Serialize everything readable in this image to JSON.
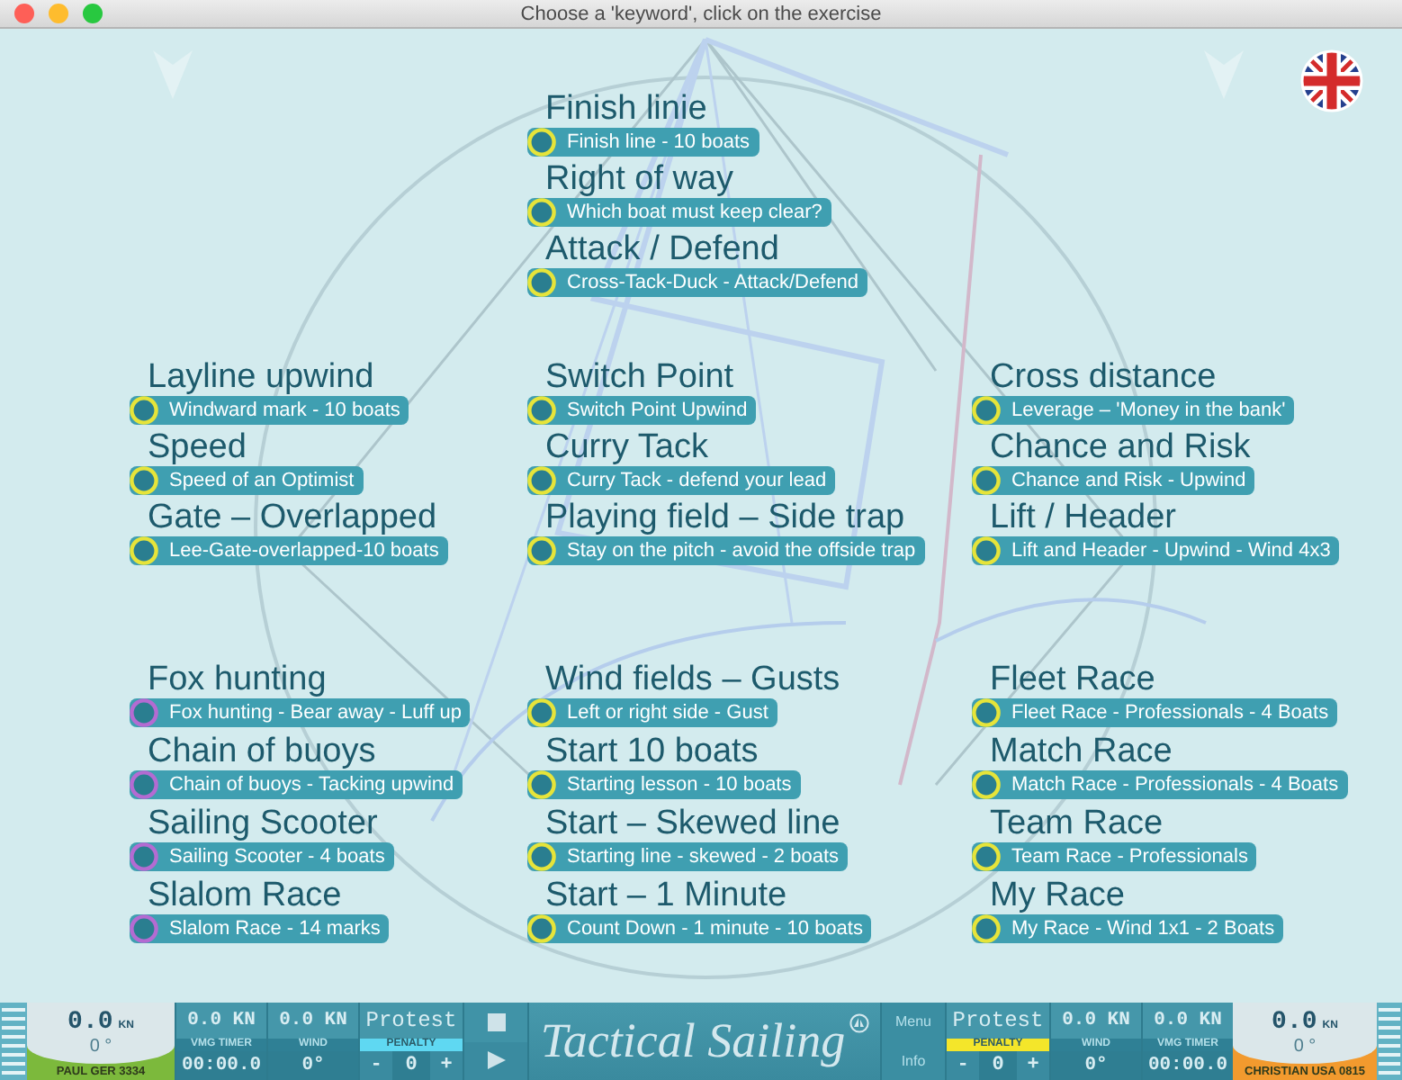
{
  "window": {
    "title": "Choose a 'keyword', click on the exercise"
  },
  "top_group": {
    "items": [
      {
        "heading": "Finish linie",
        "exercise": "Finish line - 10 boats",
        "color": "#e6e43a"
      },
      {
        "heading": "Right of way",
        "exercise": "Which boat must keep clear?",
        "color": "#e6e43a"
      },
      {
        "heading": "Attack / Defend",
        "exercise": "Cross-Tack-Duck - Attack/Defend",
        "color": "#e6e43a"
      }
    ]
  },
  "rows": [
    {
      "columns": [
        {
          "items": [
            {
              "heading": "Layline upwind",
              "exercise": "Windward mark - 10 boats",
              "color": "#e6e43a"
            },
            {
              "heading": "Speed",
              "exercise": "Speed of an Optimist",
              "color": "#e6e43a"
            },
            {
              "heading": "Gate – Overlapped",
              "exercise": "Lee-Gate-overlapped-10 boats",
              "color": "#e6e43a"
            }
          ]
        },
        {
          "items": [
            {
              "heading": "Switch Point",
              "exercise": "Switch Point Upwind",
              "color": "#e6e43a"
            },
            {
              "heading": "Curry Tack",
              "exercise": "Curry Tack - defend your lead",
              "color": "#e6e43a"
            },
            {
              "heading": "Playing field – Side trap",
              "exercise": "Stay on the pitch - avoid the offside trap",
              "color": "#e6e43a"
            }
          ]
        },
        {
          "items": [
            {
              "heading": "Cross distance",
              "exercise": "Leverage – 'Money in the bank'",
              "color": "#e6e43a"
            },
            {
              "heading": "Chance and Risk",
              "exercise": "Chance and Risk - Upwind",
              "color": "#e6e43a"
            },
            {
              "heading": "Lift / Header",
              "exercise": "Lift and Header - Upwind - Wind 4x3",
              "color": "#e6e43a"
            }
          ]
        }
      ]
    },
    {
      "columns": [
        {
          "items": [
            {
              "heading": "Fox hunting",
              "exercise": "Fox hunting - Bear away - Luff up",
              "color": "#b46bd2"
            },
            {
              "heading": "Chain of buoys",
              "exercise": "Chain of buoys - Tacking upwind",
              "color": "#b46bd2"
            },
            {
              "heading": "Sailing Scooter",
              "exercise": "Sailing Scooter - 4 boats",
              "color": "#b46bd2"
            },
            {
              "heading": "Slalom Race",
              "exercise": "Slalom Race - 14 marks",
              "color": "#b46bd2"
            }
          ]
        },
        {
          "items": [
            {
              "heading": "Wind fields – Gusts",
              "exercise": "Left or right side - Gust",
              "color": "#e6e43a"
            },
            {
              "heading": "Start 10 boats",
              "exercise": "Starting lesson - 10 boats",
              "color": "#e6e43a"
            },
            {
              "heading": "Start – Skewed line",
              "exercise": "Starting line - skewed - 2 boats",
              "color": "#e6e43a"
            },
            {
              "heading": "Start – 1 Minute",
              "exercise": "Count Down - 1 minute - 10 boats",
              "color": "#e6e43a"
            }
          ]
        },
        {
          "items": [
            {
              "heading": "Fleet Race",
              "exercise": "Fleet Race - Professionals - 4 Boats",
              "color": "#e6e43a"
            },
            {
              "heading": "Match Race",
              "exercise": "Match Race - Professionals - 4 Boats",
              "color": "#e6e43a"
            },
            {
              "heading": "Team Race",
              "exercise": "Team Race - Professionals",
              "color": "#e6e43a"
            },
            {
              "heading": "My Race",
              "exercise": "My Race - Wind 1x1 - 2 Boats",
              "color": "#e6e43a"
            }
          ]
        }
      ]
    }
  ],
  "bottom_bar": {
    "players": [
      {
        "kind": "left",
        "gauge": {
          "speed": "0.0",
          "unit": "KN",
          "angle": "0 °",
          "name": "PAUL GER 3334",
          "color": "#7cb93c"
        },
        "vmg": {
          "speed": "0.0 KN",
          "label": "VMG TIMER",
          "value": "00:00.0"
        },
        "wind": {
          "speed": "0.0 KN",
          "label": "WIND",
          "value": "0°"
        },
        "protest": {
          "label": "Protest",
          "penalty": "PENALTY",
          "color": "#5fd8f2",
          "minus": "-",
          "count": "0",
          "plus": "+"
        }
      },
      {
        "kind": "right",
        "gauge": {
          "speed": "0.0",
          "unit": "KN",
          "angle": "0 °",
          "name": "CHRISTIAN USA 0815",
          "color": "#f29a2e"
        },
        "vmg": {
          "speed": "0.0 KN",
          "label": "VMG TIMER",
          "value": "00:00.0"
        },
        "wind": {
          "speed": "0.0 KN",
          "label": "WIND",
          "value": "0°"
        },
        "protest": {
          "label": "Protest",
          "penalty": "PENALTY",
          "color": "#f4e62a",
          "minus": "-",
          "count": "0",
          "plus": "+"
        }
      }
    ],
    "logo": "Tactical Sailing",
    "menu": "Menu",
    "info": "Info"
  }
}
